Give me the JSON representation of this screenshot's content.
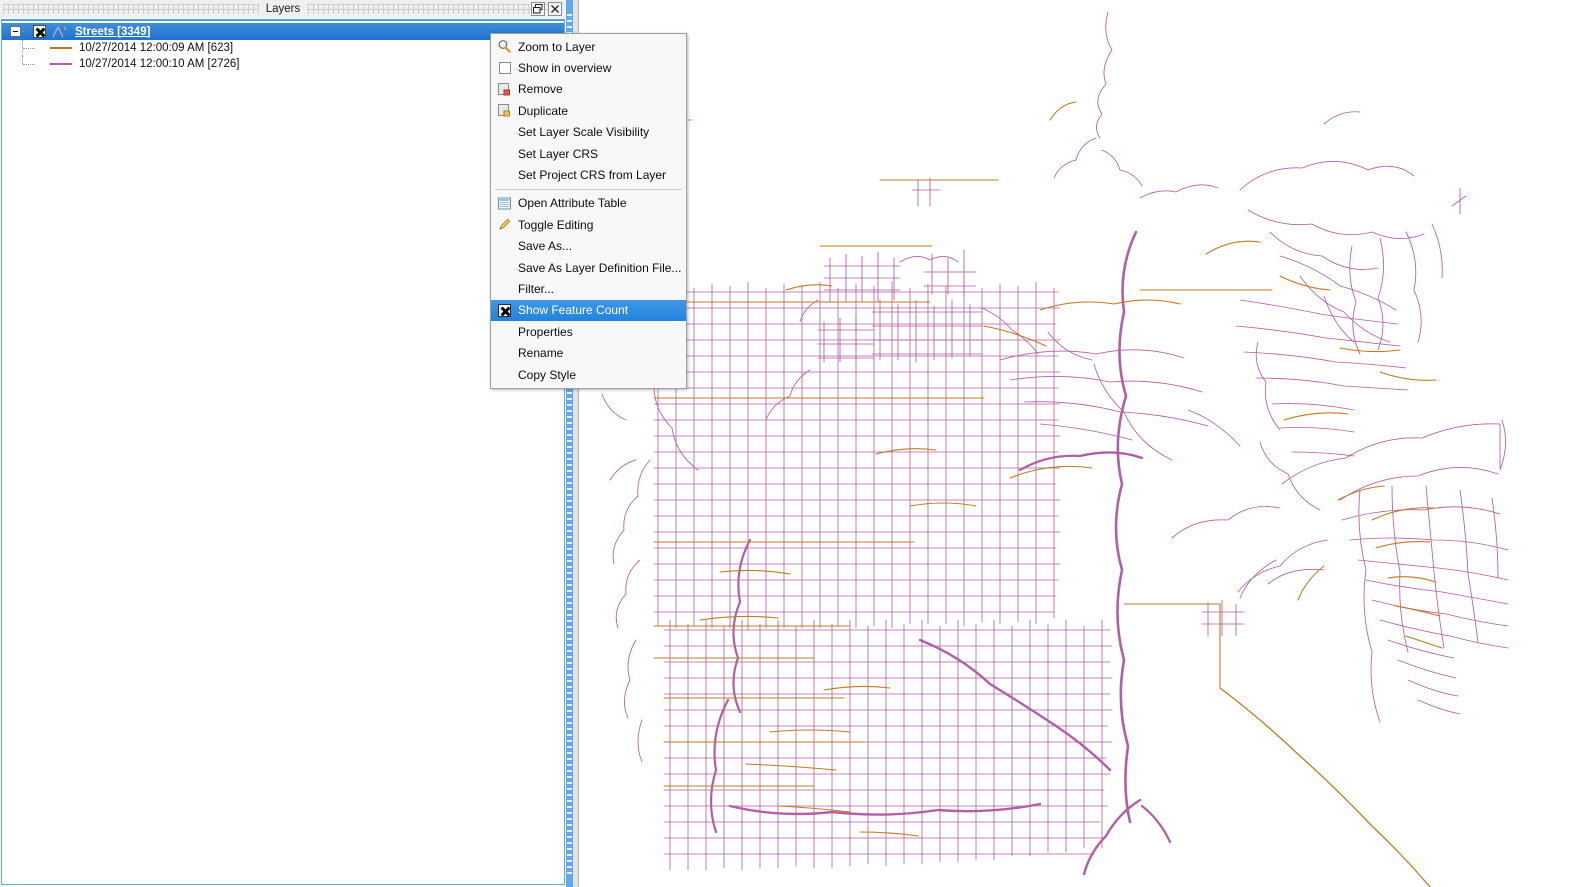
{
  "panel": {
    "title": "Layers",
    "float_button": "float-restore",
    "close_button": "close"
  },
  "layer_tree": {
    "root": {
      "label": "Streets [3349]",
      "checked": true,
      "expanded": true,
      "selected": true
    },
    "children": [
      {
        "label": "10/27/2014 12:00:09 AM [623]",
        "color": "#c07a22"
      },
      {
        "label": "10/27/2014 12:00:10 AM [2726]",
        "color": "#b25fa5"
      }
    ]
  },
  "context_menu": {
    "items": [
      {
        "label": "Zoom to Layer",
        "icon": "magnifier-icon",
        "selected": false
      },
      {
        "label": "Show in overview",
        "icon": "checkbox-empty-icon",
        "selected": false
      },
      {
        "label": "Remove",
        "icon": "remove-layer-icon",
        "selected": false
      },
      {
        "label": "Duplicate",
        "icon": "duplicate-layer-icon",
        "selected": false
      },
      {
        "label": "Set Layer Scale Visibility",
        "icon": "none",
        "selected": false
      },
      {
        "label": "Set Layer CRS",
        "icon": "none",
        "selected": false
      },
      {
        "label": "Set Project CRS from Layer",
        "icon": "none",
        "selected": false
      },
      {
        "label": "separator",
        "icon": "separator",
        "selected": false
      },
      {
        "label": "Open Attribute Table",
        "icon": "table-icon",
        "selected": false
      },
      {
        "label": "Toggle Editing",
        "icon": "pencil-icon",
        "selected": false
      },
      {
        "label": "Save As...",
        "icon": "none",
        "selected": false
      },
      {
        "label": "Save As Layer Definition File...",
        "icon": "none",
        "selected": false
      },
      {
        "label": "Filter...",
        "icon": "none",
        "selected": false
      },
      {
        "label": "Show Feature Count",
        "icon": "checkbox-checked-icon",
        "selected": true
      },
      {
        "label": "Properties",
        "icon": "none",
        "selected": false
      },
      {
        "label": "Rename",
        "icon": "none",
        "selected": false
      },
      {
        "label": "Copy Style",
        "icon": "none",
        "selected": false
      }
    ]
  },
  "map": {
    "background": "#ffffff",
    "stroke_primary": "#b25fa5",
    "stroke_secondary": "#c07a22"
  },
  "colors": {
    "selection_blue": "#2a7fd4",
    "menu_highlight": "#2f8ce0",
    "splitter": "#62a9e8",
    "panel_chrome": "#f0f0f0"
  }
}
